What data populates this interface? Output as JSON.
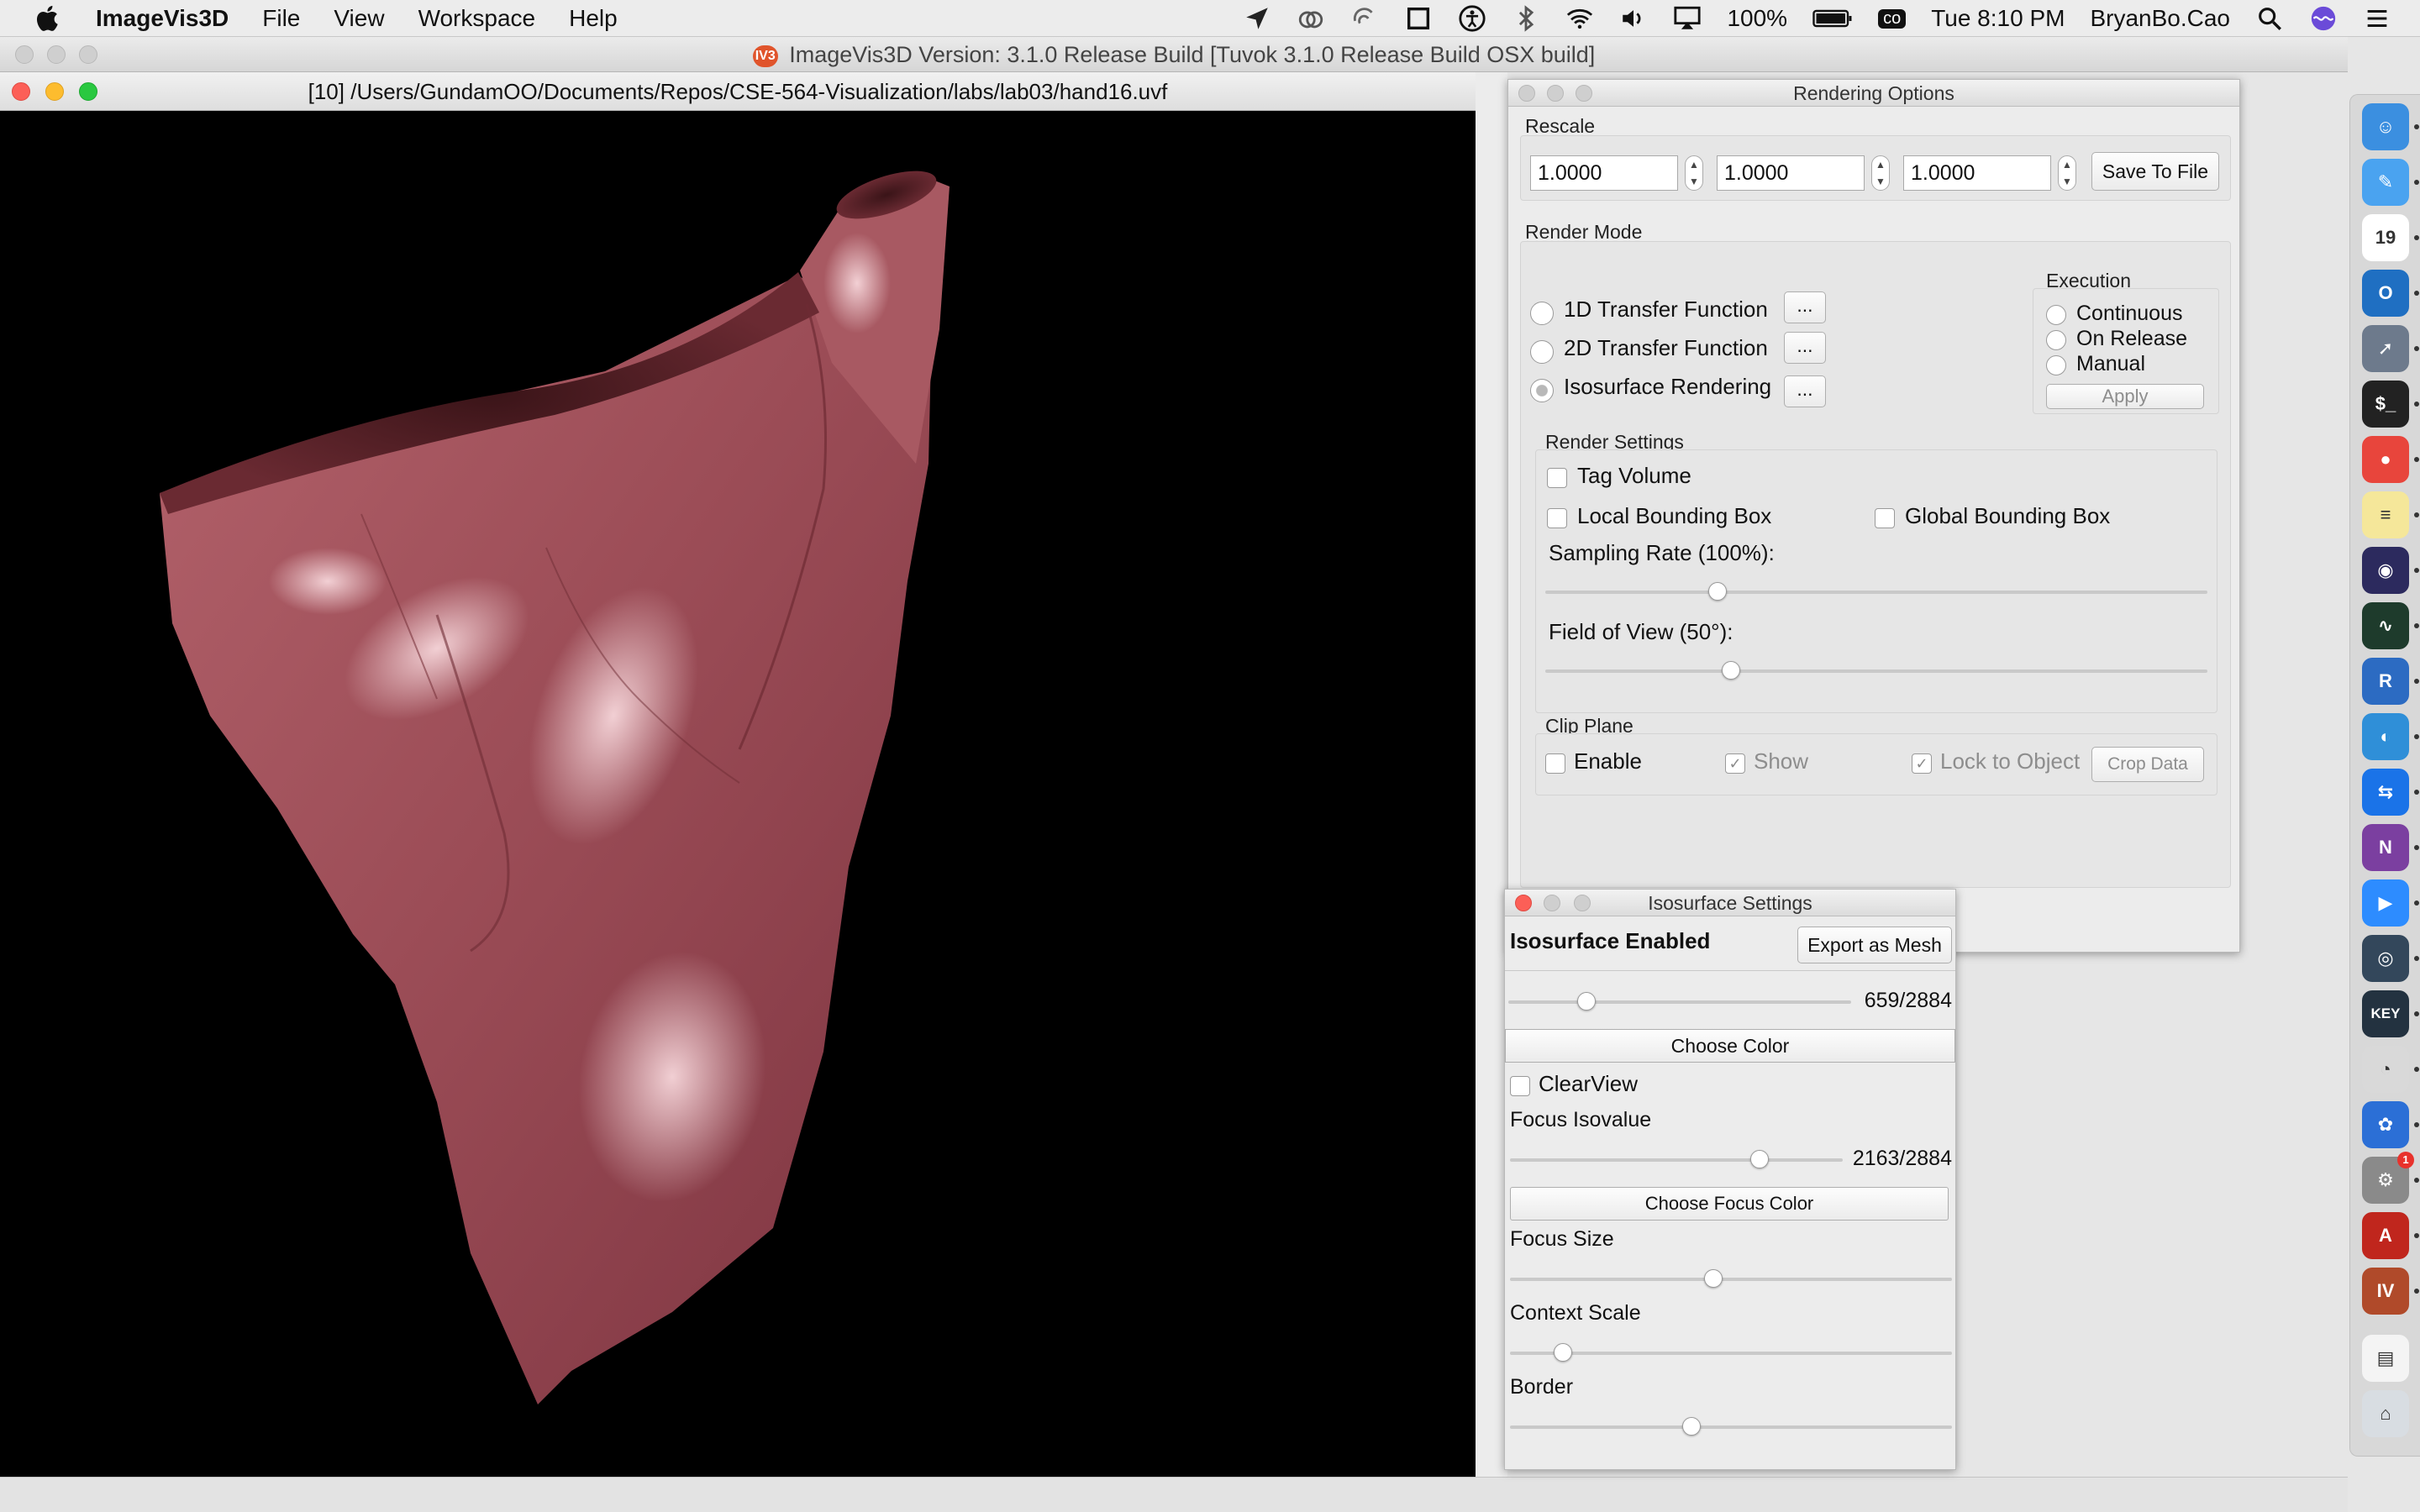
{
  "menubar": {
    "app_name": "ImageVis3D",
    "items": [
      "File",
      "View",
      "Workspace",
      "Help"
    ],
    "battery": "100%",
    "clock": "Tue 8:10 PM",
    "user": "BryanBo.Cao",
    "cc_label": "co",
    "icons": [
      "location-icon",
      "creative-cloud-icon",
      "sync-icon",
      "crop-icon",
      "accessibility-icon",
      "bluetooth-icon",
      "wifi-icon",
      "volume-icon",
      "airplay-icon",
      "battery-icon",
      "spotlight-icon",
      "siri-icon",
      "notification-center-icon"
    ]
  },
  "main_window": {
    "title": "ImageVis3D Version: 3.1.0 Release Build [Tuvok 3.1.0 Release Build OSX build]",
    "badge": "IV3"
  },
  "document": {
    "title": "[10] /Users/GundamOO/Documents/Repos/CSE-564-Visualization/labs/lab03/hand16.uvf"
  },
  "rendering_options": {
    "title": "Rendering Options",
    "rescale": {
      "label": "Rescale",
      "x": "1.0000",
      "y": "1.0000",
      "z": "1.0000",
      "save_button": "Save To File"
    },
    "render_mode": {
      "label": "Render Mode",
      "options": [
        {
          "label": "1D Transfer Function",
          "more": "..."
        },
        {
          "label": "2D Transfer Function",
          "more": "..."
        },
        {
          "label": "Isosurface Rendering",
          "more": "..."
        }
      ],
      "execution": {
        "label": "Execution",
        "options": [
          "Continuous",
          "On Release",
          "Manual"
        ],
        "apply": "Apply"
      }
    },
    "render_settings": {
      "label": "Render Settings",
      "tag_volume": "Tag Volume",
      "local_bbox": "Local Bounding Box",
      "global_bbox": "Global Bounding Box",
      "sampling_rate": "Sampling Rate (100%):",
      "sampling_rate_level": 0.26,
      "field_of_view": "Field of View (50°):",
      "field_of_view_level": 0.28
    },
    "clip_plane": {
      "label": "Clip Plane",
      "enable": "Enable",
      "show": "Show",
      "lock": "Lock to Object",
      "crop": "Crop Data"
    }
  },
  "isosurface_settings": {
    "title": "Isosurface Settings",
    "enabled_label": "Isosurface Enabled",
    "export_button": "Export as Mesh",
    "isovalue": "659/2884",
    "isovalue_level": 0.228,
    "choose_color": "Choose Color",
    "clearview": "ClearView",
    "focus_isovalue_label": "Focus Isovalue",
    "focus_isovalue": "2163/2884",
    "focus_isovalue_level": 0.75,
    "choose_focus_color": "Choose Focus Color",
    "focus_size_label": "Focus Size",
    "focus_size_level": 0.46,
    "context_scale_label": "Context Scale",
    "context_scale_level": 0.12,
    "border_label": "Border",
    "border_level": 0.41
  },
  "dock": {
    "apps": [
      {
        "name": "finder-icon",
        "color": "#3b8fe0",
        "glyph": "☺"
      },
      {
        "name": "pen-app-icon",
        "color": "#4aa3f0",
        "glyph": "✎"
      },
      {
        "name": "calendar-icon",
        "color": "#ffffff",
        "glyph": "19"
      },
      {
        "name": "outlook-icon",
        "color": "#1f6fc2",
        "glyph": "O"
      },
      {
        "name": "launchpad-icon",
        "color": "#6d7a8c",
        "glyph": "➚"
      },
      {
        "name": "terminal-icon",
        "color": "#222222",
        "glyph": "$_"
      },
      {
        "name": "chrome-icon",
        "color": "#e8453c",
        "glyph": "●"
      },
      {
        "name": "notes-icon",
        "color": "#f5e79a",
        "glyph": "≡"
      },
      {
        "name": "eclipse-icon",
        "color": "#2c2a5e",
        "glyph": "◉"
      },
      {
        "name": "activity-monitor-icon",
        "color": "#1e3b2c",
        "glyph": "∿"
      },
      {
        "name": "r-icon",
        "color": "#2c6bc2",
        "glyph": "R"
      },
      {
        "name": "browser-icon",
        "color": "#2f8fd8",
        "glyph": "◐"
      },
      {
        "name": "teamviewer-icon",
        "color": "#1a73e8",
        "glyph": "⇆"
      },
      {
        "name": "onenote-icon",
        "color": "#7b3fa0",
        "glyph": "N"
      },
      {
        "name": "zoom-icon",
        "color": "#2d8cff",
        "glyph": "▶"
      },
      {
        "name": "quicktime-icon",
        "color": "#33475b",
        "glyph": "◎"
      },
      {
        "name": "keynote-icon",
        "color": "#233240",
        "glyph": "KEY"
      },
      {
        "name": "nuclear-icon",
        "color": "#d9d9d9",
        "glyph": "◔"
      },
      {
        "name": "colors-icon",
        "color": "#2b6fd6",
        "glyph": "✿"
      },
      {
        "name": "system-preferences-icon",
        "color": "#8a8a8a",
        "glyph": "⚙"
      },
      {
        "name": "acrobat-icon",
        "color": "#c0261d",
        "glyph": "A"
      },
      {
        "name": "imagevis3d-icon",
        "color": "#b04a2a",
        "glyph": "IV"
      },
      {
        "name": "document-icon",
        "color": "#f4f4f4",
        "glyph": "▤"
      },
      {
        "name": "trash-icon",
        "color": "#d8dde2",
        "glyph": "⌂"
      }
    ],
    "badge": "1"
  },
  "colors": {
    "surface": "#a4545c",
    "surface_highlight": "#e9b7bd",
    "viewport": "#000000",
    "close": "#fc5f57",
    "minimize": "#fdbc2e",
    "zoom": "#29c840"
  }
}
